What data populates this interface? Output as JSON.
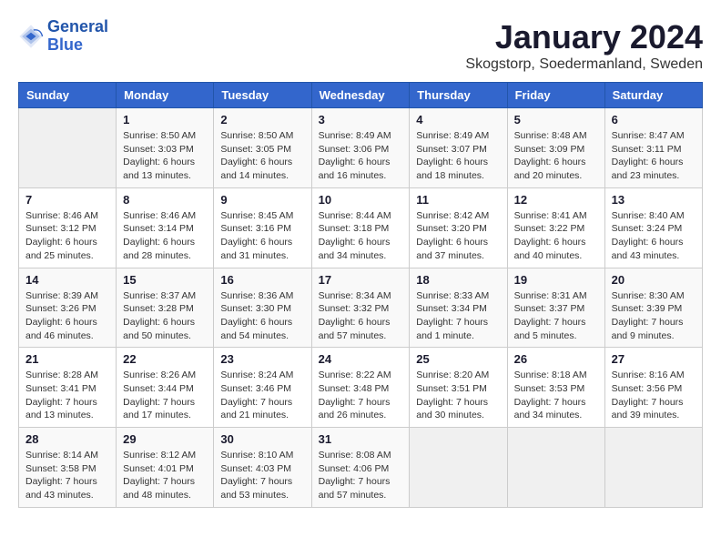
{
  "header": {
    "logo_line1": "General",
    "logo_line2": "Blue",
    "month_year": "January 2024",
    "location": "Skogstorp, Soedermanland, Sweden"
  },
  "days_of_week": [
    "Sunday",
    "Monday",
    "Tuesday",
    "Wednesday",
    "Thursday",
    "Friday",
    "Saturday"
  ],
  "weeks": [
    [
      {
        "day": "",
        "info": ""
      },
      {
        "day": "1",
        "info": "Sunrise: 8:50 AM\nSunset: 3:03 PM\nDaylight: 6 hours\nand 13 minutes."
      },
      {
        "day": "2",
        "info": "Sunrise: 8:50 AM\nSunset: 3:05 PM\nDaylight: 6 hours\nand 14 minutes."
      },
      {
        "day": "3",
        "info": "Sunrise: 8:49 AM\nSunset: 3:06 PM\nDaylight: 6 hours\nand 16 minutes."
      },
      {
        "day": "4",
        "info": "Sunrise: 8:49 AM\nSunset: 3:07 PM\nDaylight: 6 hours\nand 18 minutes."
      },
      {
        "day": "5",
        "info": "Sunrise: 8:48 AM\nSunset: 3:09 PM\nDaylight: 6 hours\nand 20 minutes."
      },
      {
        "day": "6",
        "info": "Sunrise: 8:47 AM\nSunset: 3:11 PM\nDaylight: 6 hours\nand 23 minutes."
      }
    ],
    [
      {
        "day": "7",
        "info": "Sunrise: 8:46 AM\nSunset: 3:12 PM\nDaylight: 6 hours\nand 25 minutes."
      },
      {
        "day": "8",
        "info": "Sunrise: 8:46 AM\nSunset: 3:14 PM\nDaylight: 6 hours\nand 28 minutes."
      },
      {
        "day": "9",
        "info": "Sunrise: 8:45 AM\nSunset: 3:16 PM\nDaylight: 6 hours\nand 31 minutes."
      },
      {
        "day": "10",
        "info": "Sunrise: 8:44 AM\nSunset: 3:18 PM\nDaylight: 6 hours\nand 34 minutes."
      },
      {
        "day": "11",
        "info": "Sunrise: 8:42 AM\nSunset: 3:20 PM\nDaylight: 6 hours\nand 37 minutes."
      },
      {
        "day": "12",
        "info": "Sunrise: 8:41 AM\nSunset: 3:22 PM\nDaylight: 6 hours\nand 40 minutes."
      },
      {
        "day": "13",
        "info": "Sunrise: 8:40 AM\nSunset: 3:24 PM\nDaylight: 6 hours\nand 43 minutes."
      }
    ],
    [
      {
        "day": "14",
        "info": "Sunrise: 8:39 AM\nSunset: 3:26 PM\nDaylight: 6 hours\nand 46 minutes."
      },
      {
        "day": "15",
        "info": "Sunrise: 8:37 AM\nSunset: 3:28 PM\nDaylight: 6 hours\nand 50 minutes."
      },
      {
        "day": "16",
        "info": "Sunrise: 8:36 AM\nSunset: 3:30 PM\nDaylight: 6 hours\nand 54 minutes."
      },
      {
        "day": "17",
        "info": "Sunrise: 8:34 AM\nSunset: 3:32 PM\nDaylight: 6 hours\nand 57 minutes."
      },
      {
        "day": "18",
        "info": "Sunrise: 8:33 AM\nSunset: 3:34 PM\nDaylight: 7 hours\nand 1 minute."
      },
      {
        "day": "19",
        "info": "Sunrise: 8:31 AM\nSunset: 3:37 PM\nDaylight: 7 hours\nand 5 minutes."
      },
      {
        "day": "20",
        "info": "Sunrise: 8:30 AM\nSunset: 3:39 PM\nDaylight: 7 hours\nand 9 minutes."
      }
    ],
    [
      {
        "day": "21",
        "info": "Sunrise: 8:28 AM\nSunset: 3:41 PM\nDaylight: 7 hours\nand 13 minutes."
      },
      {
        "day": "22",
        "info": "Sunrise: 8:26 AM\nSunset: 3:44 PM\nDaylight: 7 hours\nand 17 minutes."
      },
      {
        "day": "23",
        "info": "Sunrise: 8:24 AM\nSunset: 3:46 PM\nDaylight: 7 hours\nand 21 minutes."
      },
      {
        "day": "24",
        "info": "Sunrise: 8:22 AM\nSunset: 3:48 PM\nDaylight: 7 hours\nand 26 minutes."
      },
      {
        "day": "25",
        "info": "Sunrise: 8:20 AM\nSunset: 3:51 PM\nDaylight: 7 hours\nand 30 minutes."
      },
      {
        "day": "26",
        "info": "Sunrise: 8:18 AM\nSunset: 3:53 PM\nDaylight: 7 hours\nand 34 minutes."
      },
      {
        "day": "27",
        "info": "Sunrise: 8:16 AM\nSunset: 3:56 PM\nDaylight: 7 hours\nand 39 minutes."
      }
    ],
    [
      {
        "day": "28",
        "info": "Sunrise: 8:14 AM\nSunset: 3:58 PM\nDaylight: 7 hours\nand 43 minutes."
      },
      {
        "day": "29",
        "info": "Sunrise: 8:12 AM\nSunset: 4:01 PM\nDaylight: 7 hours\nand 48 minutes."
      },
      {
        "day": "30",
        "info": "Sunrise: 8:10 AM\nSunset: 4:03 PM\nDaylight: 7 hours\nand 53 minutes."
      },
      {
        "day": "31",
        "info": "Sunrise: 8:08 AM\nSunset: 4:06 PM\nDaylight: 7 hours\nand 57 minutes."
      },
      {
        "day": "",
        "info": ""
      },
      {
        "day": "",
        "info": ""
      },
      {
        "day": "",
        "info": ""
      }
    ]
  ]
}
